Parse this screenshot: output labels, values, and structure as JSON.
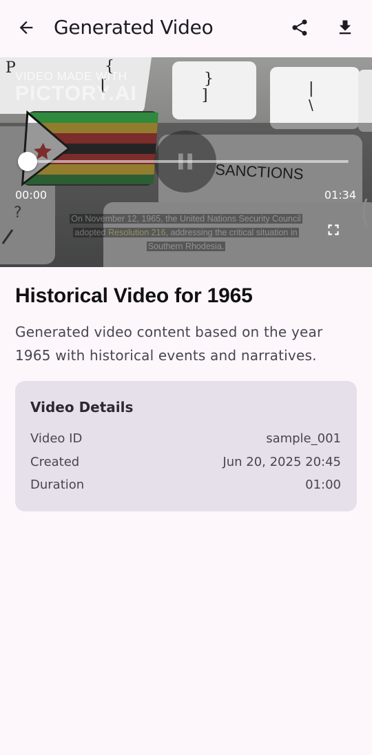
{
  "appbar": {
    "title": "Generated Video",
    "back_icon": "arrow-back-icon",
    "share_icon": "share-icon",
    "download_icon": "download-icon"
  },
  "player": {
    "watermark_line1": "VIDEO MADE WITH",
    "watermark_line2": "PICTORY.AI",
    "current_time": "00:00",
    "total_time": "01:34",
    "progress": 0,
    "state_icon": "pause-icon",
    "fullscreen_icon": "fullscreen-icon",
    "caption_part1": "On November 12, 1965, the United Nations Security Council",
    "caption_part2a": "adopted ",
    "caption_highlight": "Resolution 216",
    "caption_part2b": ", addressing the critical situation in",
    "caption_part3": "Southern Rhodesia.",
    "scene_sign": "SANCTIONS"
  },
  "info": {
    "heading": "Historical Video for 1965",
    "description": "Generated video content based on the year 1965 with historical events and narratives."
  },
  "details": {
    "title": "Video Details",
    "rows": [
      {
        "label": "Video ID",
        "value": "sample_001"
      },
      {
        "label": "Created",
        "value": "Jun 20, 2025 20:45"
      },
      {
        "label": "Duration",
        "value": "01:00"
      }
    ]
  },
  "colors": {
    "background": "#fdf7fc",
    "card": "#e6e0ea",
    "text_primary": "#1d1b20",
    "text_secondary": "#49454f"
  }
}
